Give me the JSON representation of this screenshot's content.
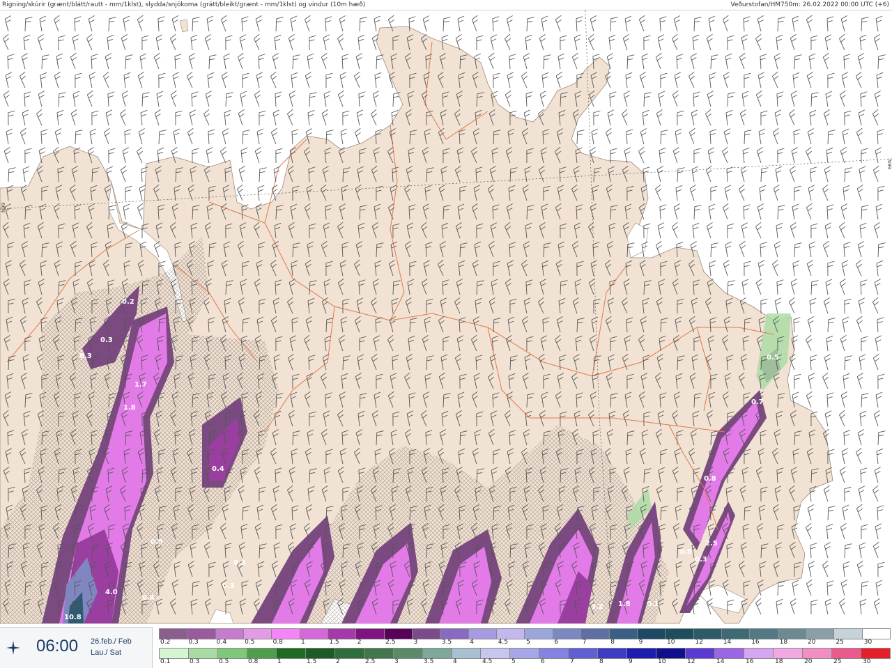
{
  "header": {
    "left_text": "Rigning/skúrir (grænt/blátt/rautt - mm/1klst), slydda/snjókoma (grátt/bleikt/grænt - mm/1klst) og vindur (10m hæð)",
    "right_text": "Veðurstofan/HM750m: 26.02.2022 00:00 UTC (+6)"
  },
  "latitude_labels": [
    "N99",
    "N99"
  ],
  "clock": {
    "icon": "compass-star-icon",
    "time": "06:00",
    "date_line1": "26.feb./ Feb",
    "date_line2": "Lau./ Sat"
  },
  "map_labels": [
    "0.2",
    "0.3",
    "0.3",
    "1.7",
    "1.8",
    "0.4",
    "0.5",
    "0.3",
    "0.3",
    "4.0",
    "0.4",
    "10.8",
    "1.8",
    "3.2",
    "0.8",
    "0.5",
    "0.7",
    "0.8",
    "2.5",
    "0.3",
    "0.1"
  ],
  "legend": {
    "snow_scale": {
      "labels": [
        "0.2",
        "0.3",
        "0.4",
        "0.5",
        "0.8",
        "1",
        "1.5",
        "2",
        "2.5",
        "3",
        "3.5",
        "4",
        "4.5",
        "5",
        "6",
        "7",
        "8",
        "9",
        "10",
        "12",
        "14",
        "16",
        "18",
        "20",
        "25",
        "30"
      ],
      "colors": [
        "#8a5f8e",
        "#9b5a9d",
        "#c67ad0",
        "#e59ae8",
        "#f385f4",
        "#d36ad8",
        "#a43aa7",
        "#7f1380",
        "#59005b",
        "#7a4a8a",
        "#8a6ac0",
        "#a89ae0",
        "#c4b7f0",
        "#9ba6dd",
        "#7b88c2",
        "#5d6fa5",
        "#3a5f86",
        "#1c4966",
        "#1e4e5e",
        "#2c5b68",
        "#3d6a74",
        "#537a84",
        "#6c8a92",
        "#8aa0a8",
        "#c5d2d6",
        "#ffffff"
      ]
    },
    "rain_scale": {
      "labels": [
        "0.1",
        "0.3",
        "0.5",
        "0.8",
        "1",
        "1.5",
        "2",
        "2.5",
        "3",
        "3.5",
        "4",
        "4.5",
        "5",
        "6",
        "7",
        "8",
        "9",
        "10",
        "12",
        "14",
        "16",
        "18",
        "20",
        "25",
        "30"
      ],
      "colors": [
        "#d6f5d2",
        "#a9dca3",
        "#7fc77a",
        "#4f9e4c",
        "#1e6a22",
        "#1c5a26",
        "#2f6d3c",
        "#40784c",
        "#5a8a66",
        "#7fa89a",
        "#a9c0d2",
        "#c6c6ee",
        "#a6a6e8",
        "#8484e0",
        "#6060d4",
        "#3c3cc4",
        "#1c1cae",
        "#10108e",
        "#5a3ad0",
        "#9b66e6",
        "#d6a6f0",
        "#f2a9e2",
        "#f28fc2",
        "#ea5a8c",
        "#e6202a"
      ]
    }
  }
}
